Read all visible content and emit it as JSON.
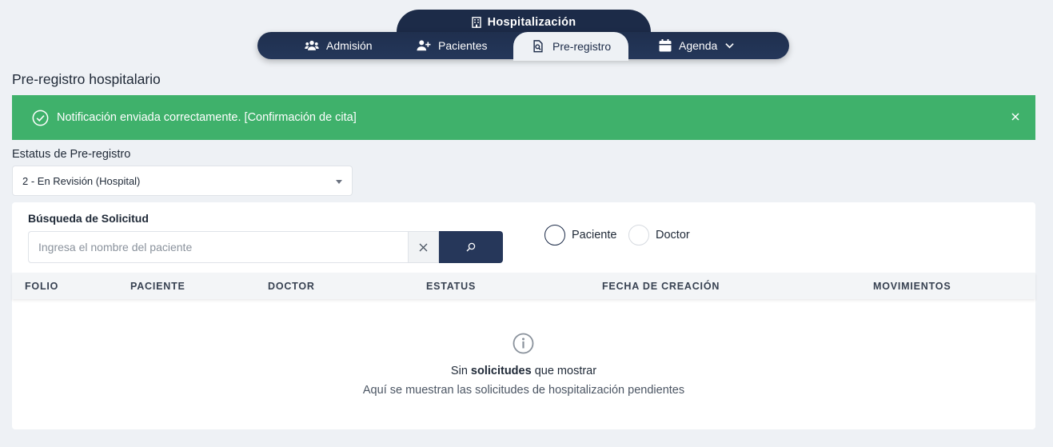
{
  "nav": {
    "section_title": "Hospitalización",
    "section_icon": "building-icon",
    "items": [
      {
        "label": "Admisión",
        "icon": "users-icon",
        "active": false
      },
      {
        "label": "Pacientes",
        "icon": "user-plus-icon",
        "active": false
      },
      {
        "label": "Pre-registro",
        "icon": "file-search-icon",
        "active": true
      },
      {
        "label": "Agenda",
        "icon": "calendar-icon",
        "active": false,
        "has_dropdown": true
      }
    ]
  },
  "page": {
    "title": "Pre-registro hospitalario"
  },
  "alert": {
    "message": "Notificación enviada correctamente. [Confirmación de cita]",
    "color": "#3fb16b"
  },
  "status_filter": {
    "label": "Estatus de Pre-registro",
    "selected": "2 - En Revisión (Hospital)"
  },
  "search": {
    "label": "Búsqueda de Solicitud",
    "placeholder": "Ingresa el nombre del paciente",
    "value": ""
  },
  "search_type": {
    "options": [
      {
        "label": "Paciente",
        "selected": true
      },
      {
        "label": "Doctor",
        "selected": false
      }
    ]
  },
  "table": {
    "columns": [
      "FOLIO",
      "PACIENTE",
      "DOCTOR",
      "ESTATUS",
      "FECHA DE CREACIÓN",
      "MOVIMIENTOS"
    ],
    "rows": []
  },
  "empty_state": {
    "title_prefix": "Sin ",
    "title_bold": "solicitudes",
    "title_suffix": " que mostrar",
    "subtitle": "Aquí se muestran las solicitudes de hospitalización pendientes"
  },
  "colors": {
    "nav_bg": "#1c2b48",
    "primary_button": "#26375a",
    "background": "#eef1f5"
  }
}
